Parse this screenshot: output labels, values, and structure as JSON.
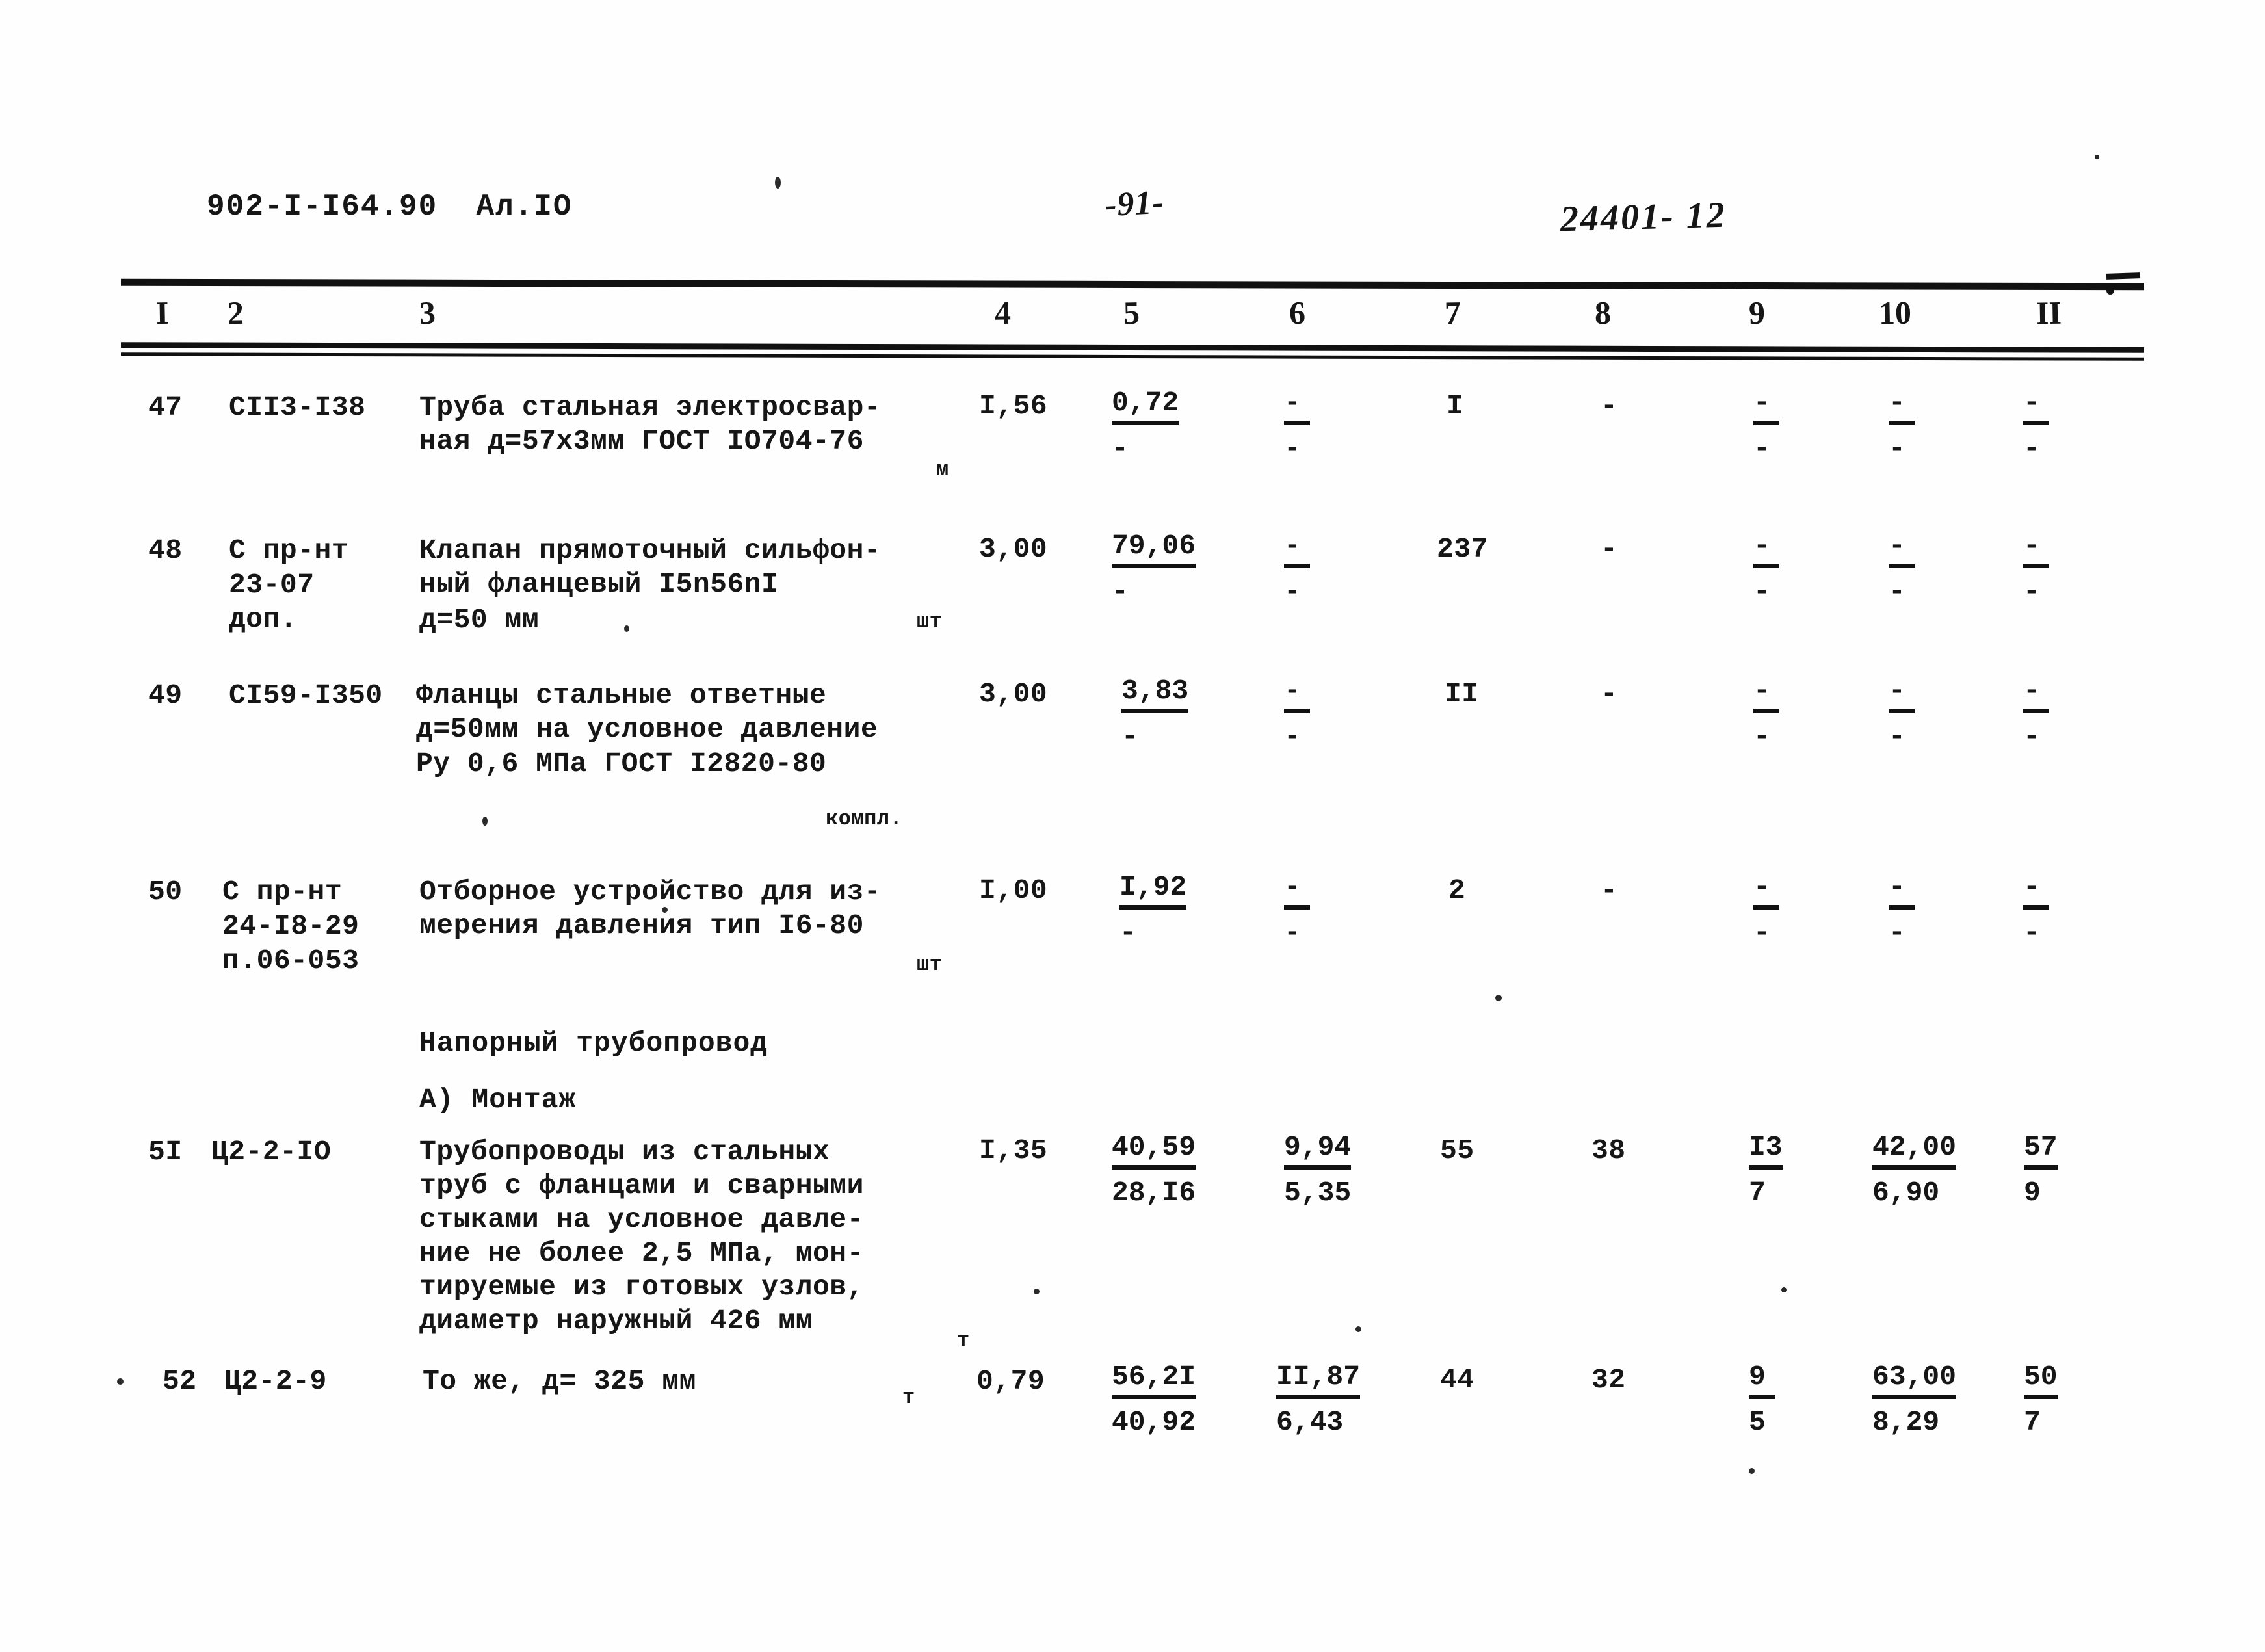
{
  "header": {
    "doc_code": "902-I-I64.90  Ал.IO",
    "page_number": "-91-",
    "stamp_code": "24401- 12"
  },
  "table": {
    "column_headers": [
      "I",
      "2",
      "3",
      "4",
      "5",
      "6",
      "7",
      "8",
      "9",
      "10",
      "II"
    ],
    "rows": [
      {
        "no": "47",
        "code": "СII3-I38",
        "desc_lines": [
          "Труба стальная электросвар-",
          "ная д=57х3мм ГОСТ IO704-76"
        ],
        "unit": "м",
        "col4": "I,56",
        "col5": {
          "top": "0,72",
          "bot": "-"
        },
        "col6": {
          "top": "-",
          "bot": "-"
        },
        "col7": "I",
        "col8": "-",
        "col9": {
          "top": "-",
          "bot": "-"
        },
        "col10": {
          "top": "-",
          "bot": "-"
        },
        "col11": {
          "top": "-",
          "bot": "-"
        }
      },
      {
        "no": "48",
        "code": "С пр-нт\n23-07\nдоп.",
        "desc_lines": [
          "Клапан прямоточный сильфон-",
          "ный фланцевый I5n56nI",
          "д=50 мм"
        ],
        "unit": "шт",
        "col4": "3,00",
        "col5": {
          "top": "79,06",
          "bot": "-"
        },
        "col6": {
          "top": "-",
          "bot": "-"
        },
        "col7": "237",
        "col8": "-",
        "col9": {
          "top": "-",
          "bot": "-"
        },
        "col10": {
          "top": "-",
          "bot": "-"
        },
        "col11": {
          "top": "-",
          "bot": "-"
        }
      },
      {
        "no": "49",
        "code": "СI59-I350",
        "desc_lines": [
          "Фланцы стальные ответные",
          "д=50мм на условное давление",
          "Ру 0,6 МПа ГОСТ I2820-80"
        ],
        "unit": "компл.",
        "col4": "3,00",
        "col5": {
          "top": "3,83",
          "bot": "-"
        },
        "col6": {
          "top": "-",
          "bot": "-"
        },
        "col7": "II",
        "col8": "-",
        "col9": {
          "top": "-",
          "bot": "-"
        },
        "col10": {
          "top": "-",
          "bot": "-"
        },
        "col11": {
          "top": "-",
          "bot": "-"
        }
      },
      {
        "no": "50",
        "code": "С пр-нт\n24-I8-29\nп.06-053",
        "desc_lines": [
          "Отборное устройство для из-",
          "мерения давления тип I6-80"
        ],
        "unit": "шт",
        "col4": "I,00",
        "col5": {
          "top": "I,92",
          "bot": "-"
        },
        "col6": {
          "top": "-",
          "bot": "-"
        },
        "col7": "2",
        "col8": "-",
        "col9": {
          "top": "-",
          "bot": "-"
        },
        "col10": {
          "top": "-",
          "bot": "-"
        },
        "col11": {
          "top": "-",
          "bot": "-"
        }
      },
      {
        "no": "5I",
        "code": "Ц2-2-IO",
        "desc_lines": [
          "Трубопроводы из стальных",
          "труб с фланцами и сварными",
          "стыками на условное давле-",
          "ние не более 2,5 МПа, мон-",
          "тируемые из готовых узлов,",
          "диаметр наружный 426 мм"
        ],
        "unit": "т",
        "col4": "I,35",
        "col5": {
          "top": "40,59",
          "bot": "28,I6"
        },
        "col6": {
          "top": "9,94",
          "bot": "5,35"
        },
        "col7": "55",
        "col8": "38",
        "col9": {
          "top": "I3",
          "bot": "7"
        },
        "col10": {
          "top": "42,00",
          "bot": "6,90"
        },
        "col11": {
          "top": "57",
          "bot": "9"
        }
      },
      {
        "no": "52",
        "code": "Ц2-2-9",
        "desc_lines": [
          "То же, д= 325 мм"
        ],
        "unit": "т",
        "col4": "0,79",
        "col5": {
          "top": "56,2I",
          "bot": "40,92"
        },
        "col6": {
          "top": "II,87",
          "bot": "6,43"
        },
        "col7": "44",
        "col8": "32",
        "col9": {
          "top": "9",
          "bot": "5"
        },
        "col10": {
          "top": "63,00",
          "bot": "8,29"
        },
        "col11": {
          "top": "50",
          "bot": "7"
        }
      }
    ],
    "section_headings": [
      {
        "text": "Напорный трубопровод"
      },
      {
        "text": "А) Монтаж"
      }
    ]
  }
}
